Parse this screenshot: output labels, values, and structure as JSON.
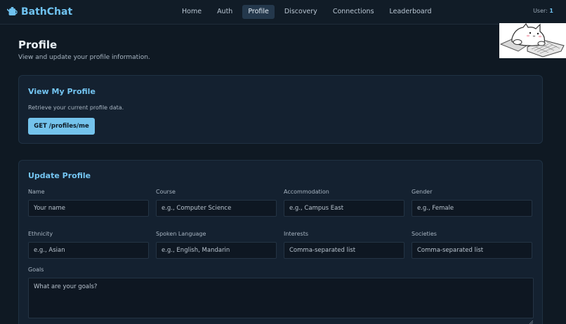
{
  "brand": {
    "name": "BathChat",
    "icon": "kettle-icon"
  },
  "nav": {
    "links": [
      {
        "label": "Home"
      },
      {
        "label": "Auth"
      },
      {
        "label": "Profile",
        "active": true
      },
      {
        "label": "Discovery"
      },
      {
        "label": "Connections"
      },
      {
        "label": "Leaderboard"
      }
    ]
  },
  "user": {
    "label": "User:",
    "id": "1"
  },
  "page": {
    "title": "Profile",
    "subtitle": "View and update your profile information."
  },
  "view_profile": {
    "title": "View My Profile",
    "description": "Retrieve your current profile data.",
    "button_label": "GET /profiles/me"
  },
  "update_profile": {
    "title": "Update Profile",
    "fields": {
      "name": {
        "label": "Name",
        "placeholder": "Your name",
        "value": ""
      },
      "course": {
        "label": "Course",
        "placeholder": "e.g., Computer Science",
        "value": ""
      },
      "accommodation": {
        "label": "Accommodation",
        "placeholder": "e.g., Campus East",
        "value": ""
      },
      "gender": {
        "label": "Gender",
        "placeholder": "e.g., Female",
        "value": ""
      },
      "ethnicity": {
        "label": "Ethnicity",
        "placeholder": "e.g., Asian",
        "value": ""
      },
      "spoken_language": {
        "label": "Spoken Language",
        "placeholder": "e.g., English, Mandarin",
        "value": ""
      },
      "interests": {
        "label": "Interests",
        "placeholder": "Comma-separated list",
        "value": ""
      },
      "societies": {
        "label": "Societies",
        "placeholder": "Comma-separated list",
        "value": ""
      },
      "goals": {
        "label": "Goals",
        "placeholder": "What are your goals?",
        "value": ""
      }
    }
  },
  "mascot": {
    "icon": "cat-typing-icon"
  },
  "colors": {
    "background": "#0f1923",
    "card": "#142130",
    "accent": "#74c5f2",
    "button": "#74c3ec",
    "nav_active": "#24384c"
  }
}
